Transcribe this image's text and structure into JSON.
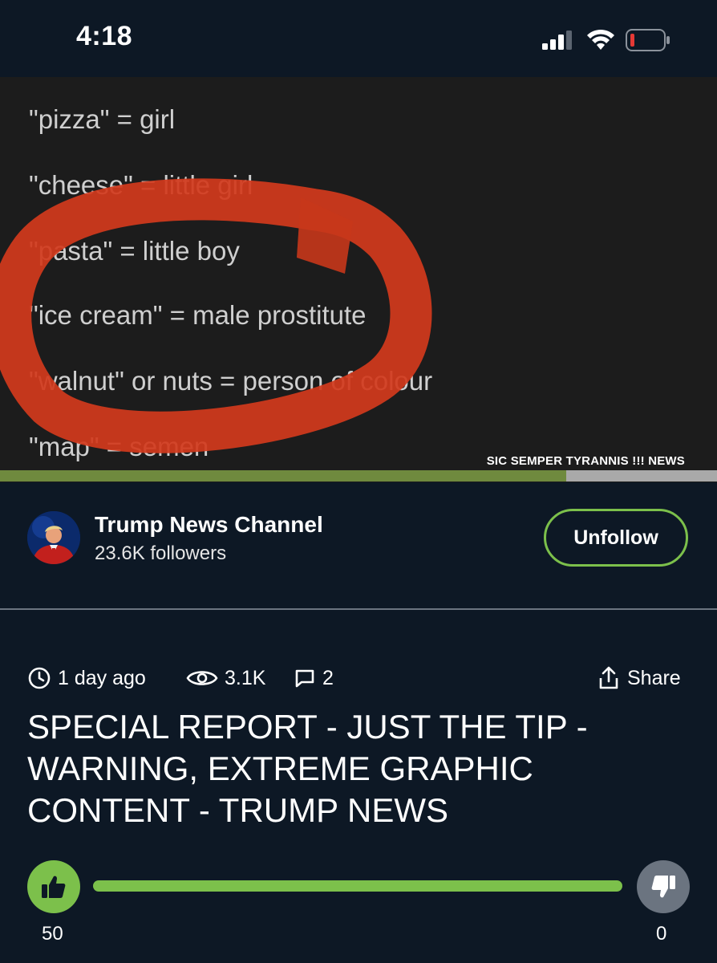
{
  "status_bar": {
    "time": "4:18"
  },
  "video": {
    "lines": [
      "\"pizza\" = girl",
      "\"cheese\" = little girl",
      "\"pasta\" = little boy",
      "\"ice cream\" = male prostitute",
      "\"walnut\" or nuts = person of colour",
      "\"map\" = semen"
    ],
    "watermark": "SIC SEMPER TYRANNIS !!! NEWS",
    "progress_fraction": 0.79,
    "colors": {
      "annotation_ring": "#d23a1c",
      "progress": "#6f8a3e"
    }
  },
  "channel": {
    "name": "Trump News Channel",
    "followers": "23.6K followers",
    "follow_button_label": "Unfollow"
  },
  "meta": {
    "age": "1 day ago",
    "views": "3.1K",
    "comments": "2",
    "share_label": "Share"
  },
  "title": "SPECIAL REPORT - JUST THE TIP - WARNING, EXTREME GRAPHIC CONTENT - TRUMP NEWS",
  "rating": {
    "likes": "50",
    "dislikes": "0",
    "like_fraction": 1.0,
    "colors": {
      "like": "#7cc04b",
      "dislike": "#6b7480"
    }
  }
}
